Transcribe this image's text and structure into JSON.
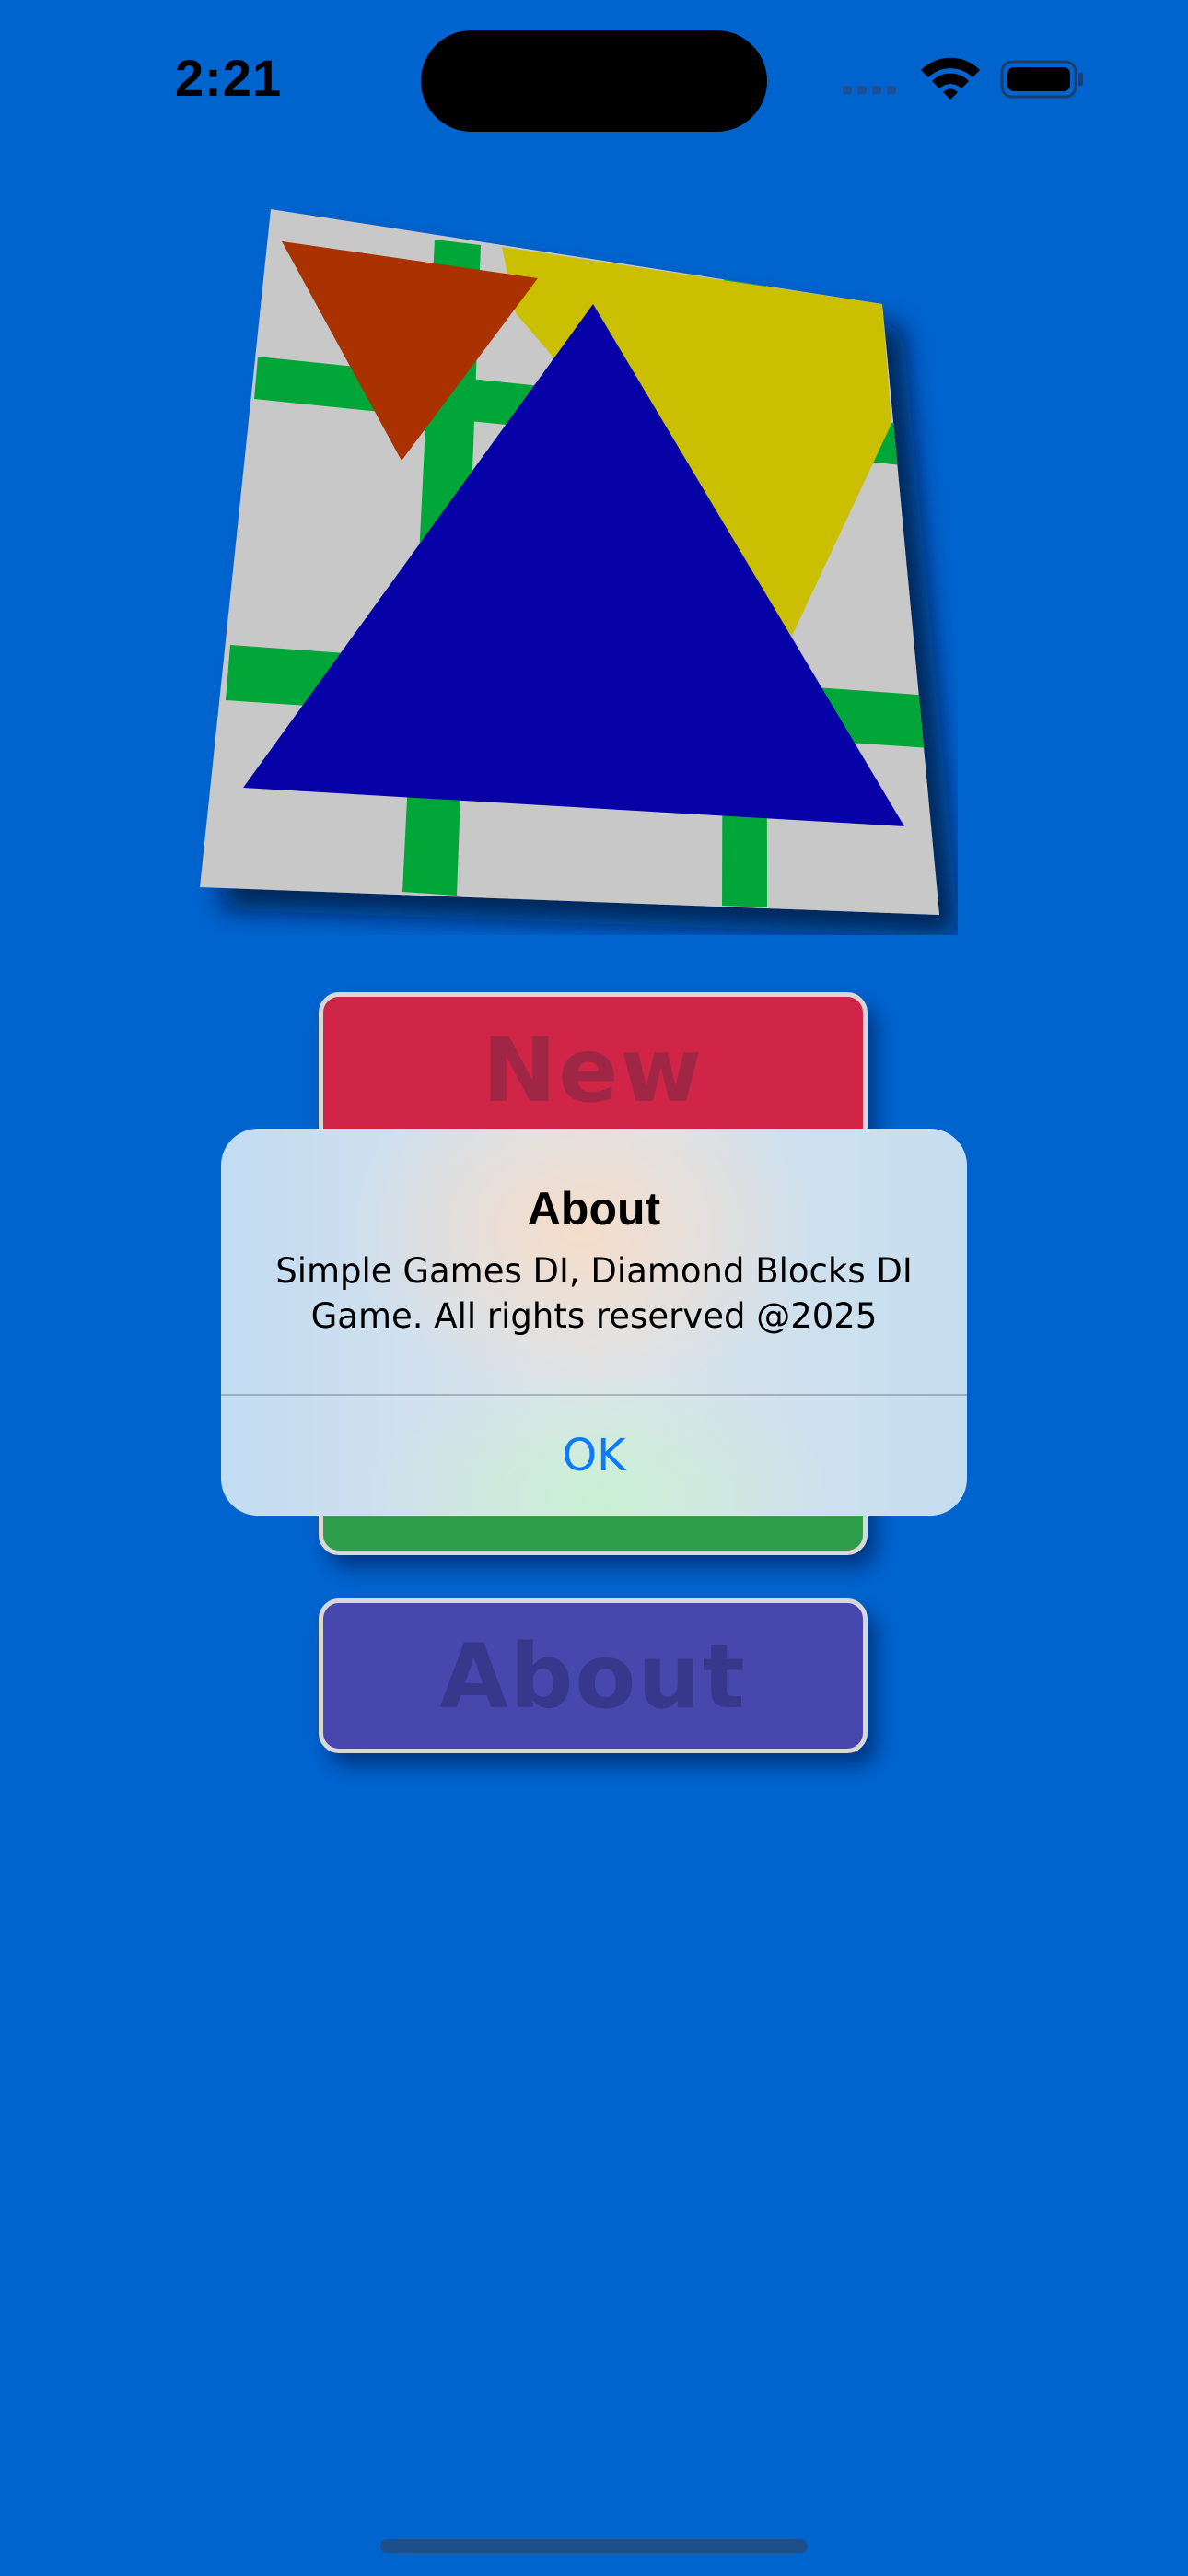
{
  "status_bar": {
    "time": "2:21"
  },
  "main_menu": {
    "new_game_label": "New Game",
    "about_label": "About"
  },
  "alert": {
    "title": "About",
    "message": "Simple Games DI, Diamond Blocks DI Game. All rights reserved @2025",
    "ok_label": "OK"
  },
  "colors": {
    "background": "#0064cf",
    "new_game_button": "#d02547",
    "green_button": "#2e9e4a",
    "about_button": "#4747ad",
    "alert_ok": "#0a7aff",
    "logo_board": "#c8c8c8",
    "logo_grid": "#00a637",
    "logo_red_triangle": "#a93200",
    "logo_yellow_shape": "#cbbf02",
    "logo_blue_triangle": "#0602a8"
  }
}
